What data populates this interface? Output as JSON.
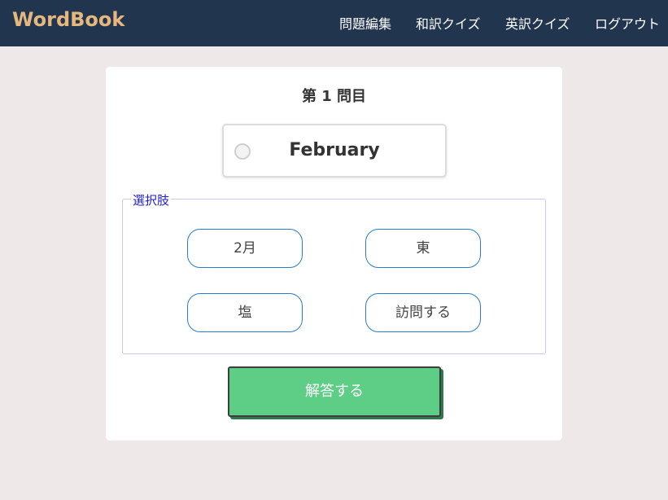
{
  "header": {
    "brand": "WordBook",
    "nav": [
      {
        "label": "問題編集"
      },
      {
        "label": "和訳クイズ"
      },
      {
        "label": "英訳クイズ"
      },
      {
        "label": "ログアウト"
      }
    ]
  },
  "quiz": {
    "question_title": "第 1 問目",
    "word": "February",
    "choices_legend": "選択肢",
    "choices": [
      "2月",
      "東",
      "塩",
      "訪問する"
    ],
    "submit_label": "解答する"
  },
  "colors": {
    "navbar_bg": "#22354e",
    "brand": "#e6b77e",
    "page_bg": "#eee9e8",
    "choice_border": "#2a7cc7",
    "submit_bg": "#5ecd86"
  }
}
